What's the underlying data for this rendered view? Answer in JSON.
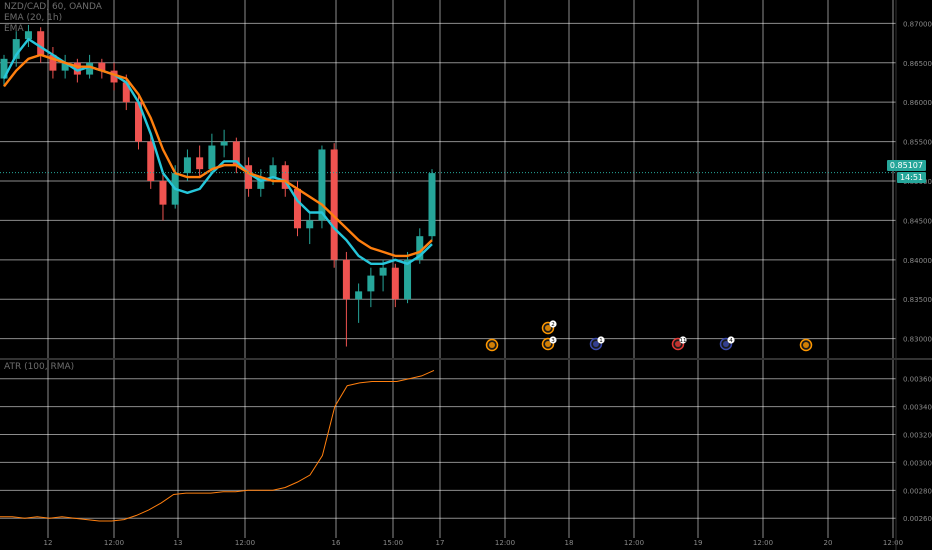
{
  "header": {
    "symbol_line": "NZD/CAD, 60, OANDA",
    "ema1_label": "EMA (20, 1h)",
    "ema2_label": "EMA"
  },
  "atr_panel": {
    "label": "ATR (100, RMA)"
  },
  "price_tags": {
    "last_price": "0.85107",
    "countdown": "14:51"
  },
  "colors": {
    "background": "#000000",
    "grid": "#ffffff",
    "up": "#26a69a",
    "down": "#ef5350",
    "ema_fast": "#26c6da",
    "ema_slow": "#ff7f0e",
    "atr": "#ff7f0e",
    "price_tag": "#26a69a"
  },
  "event_markers": [
    {
      "badge": "",
      "color": "#ff9800"
    },
    {
      "badge": "2",
      "color": "#ff9800"
    },
    {
      "badge": "3",
      "color": "#ff9800"
    },
    {
      "badge": "1",
      "color": "#3949ab"
    },
    {
      "badge": "11",
      "color": "#e53935"
    },
    {
      "badge": "4",
      "color": "#3949ab"
    },
    {
      "badge": "",
      "color": "#ff9800"
    }
  ],
  "chart_data": [
    {
      "type": "candlestick",
      "title": "NZD/CAD, 60, OANDA",
      "y_ticks": [
        "0.87000",
        "0.86500",
        "0.86000",
        "0.85500",
        "0.85000",
        "0.84500",
        "0.84000",
        "0.83500",
        "0.83000"
      ],
      "x_ticks": [
        "12",
        "12:00",
        "13",
        "12:00",
        "16",
        "15:00",
        "17",
        "12:00",
        "18",
        "12:00",
        "19",
        "12:00",
        "20",
        "12:00"
      ],
      "ylim": [
        0.8278,
        0.8722
      ],
      "grid": true,
      "series": [
        {
          "name": "EMA",
          "kind": "line",
          "y": [
            0.863,
            0.866,
            0.868,
            0.867,
            0.866,
            0.865,
            0.864,
            0.8645,
            0.864,
            0.8635,
            0.8625,
            0.86,
            0.856,
            0.851,
            0.849,
            0.8485,
            0.849,
            0.851,
            0.8525,
            0.8525,
            0.851,
            0.85,
            0.8505,
            0.85,
            0.8475,
            0.846,
            0.846,
            0.844,
            0.8425,
            0.8405,
            0.8395,
            0.8395,
            0.84,
            0.8395,
            0.8405,
            0.842
          ]
        },
        {
          "name": "EMA",
          "kind": "line",
          "y": [
            0.862,
            0.864,
            0.8655,
            0.866,
            0.8655,
            0.865,
            0.8645,
            0.8645,
            0.864,
            0.8635,
            0.863,
            0.861,
            0.858,
            0.854,
            0.851,
            0.8505,
            0.8505,
            0.8515,
            0.852,
            0.852,
            0.851,
            0.8505,
            0.85,
            0.85,
            0.849,
            0.848,
            0.847,
            0.8455,
            0.844,
            0.8425,
            0.8415,
            0.841,
            0.8405,
            0.8405,
            0.841,
            0.8425
          ]
        }
      ],
      "candles": [
        {
          "o": 0.863,
          "h": 0.866,
          "l": 0.862,
          "c": 0.8655
        },
        {
          "o": 0.8655,
          "h": 0.869,
          "l": 0.8645,
          "c": 0.868
        },
        {
          "o": 0.868,
          "h": 0.8698,
          "l": 0.867,
          "c": 0.869
        },
        {
          "o": 0.869,
          "h": 0.8695,
          "l": 0.865,
          "c": 0.866
        },
        {
          "o": 0.866,
          "h": 0.867,
          "l": 0.863,
          "c": 0.864
        },
        {
          "o": 0.864,
          "h": 0.866,
          "l": 0.863,
          "c": 0.865
        },
        {
          "o": 0.865,
          "h": 0.8655,
          "l": 0.8625,
          "c": 0.8635
        },
        {
          "o": 0.8635,
          "h": 0.866,
          "l": 0.863,
          "c": 0.865
        },
        {
          "o": 0.865,
          "h": 0.8655,
          "l": 0.863,
          "c": 0.864
        },
        {
          "o": 0.864,
          "h": 0.865,
          "l": 0.8615,
          "c": 0.8625
        },
        {
          "o": 0.8625,
          "h": 0.8635,
          "l": 0.859,
          "c": 0.86
        },
        {
          "o": 0.86,
          "h": 0.861,
          "l": 0.854,
          "c": 0.855
        },
        {
          "o": 0.855,
          "h": 0.856,
          "l": 0.849,
          "c": 0.85
        },
        {
          "o": 0.85,
          "h": 0.851,
          "l": 0.845,
          "c": 0.847
        },
        {
          "o": 0.847,
          "h": 0.852,
          "l": 0.8465,
          "c": 0.851
        },
        {
          "o": 0.851,
          "h": 0.854,
          "l": 0.85,
          "c": 0.853
        },
        {
          "o": 0.853,
          "h": 0.8545,
          "l": 0.8505,
          "c": 0.8515
        },
        {
          "o": 0.8515,
          "h": 0.856,
          "l": 0.851,
          "c": 0.8545
        },
        {
          "o": 0.8545,
          "h": 0.8565,
          "l": 0.853,
          "c": 0.855
        },
        {
          "o": 0.855,
          "h": 0.8555,
          "l": 0.851,
          "c": 0.852
        },
        {
          "o": 0.852,
          "h": 0.853,
          "l": 0.848,
          "c": 0.849
        },
        {
          "o": 0.849,
          "h": 0.8515,
          "l": 0.848,
          "c": 0.8505
        },
        {
          "o": 0.8505,
          "h": 0.853,
          "l": 0.8495,
          "c": 0.852
        },
        {
          "o": 0.852,
          "h": 0.8525,
          "l": 0.848,
          "c": 0.849
        },
        {
          "o": 0.849,
          "h": 0.85,
          "l": 0.843,
          "c": 0.844
        },
        {
          "o": 0.844,
          "h": 0.846,
          "l": 0.842,
          "c": 0.845
        },
        {
          "o": 0.845,
          "h": 0.8545,
          "l": 0.844,
          "c": 0.854
        },
        {
          "o": 0.854,
          "h": 0.8548,
          "l": 0.839,
          "c": 0.84
        },
        {
          "o": 0.84,
          "h": 0.841,
          "l": 0.829,
          "c": 0.835
        },
        {
          "o": 0.835,
          "h": 0.837,
          "l": 0.832,
          "c": 0.836
        },
        {
          "o": 0.836,
          "h": 0.839,
          "l": 0.834,
          "c": 0.838
        },
        {
          "o": 0.838,
          "h": 0.84,
          "l": 0.836,
          "c": 0.839
        },
        {
          "o": 0.839,
          "h": 0.8395,
          "l": 0.834,
          "c": 0.835
        },
        {
          "o": 0.835,
          "h": 0.841,
          "l": 0.8345,
          "c": 0.84
        },
        {
          "o": 0.84,
          "h": 0.844,
          "l": 0.8395,
          "c": 0.843
        },
        {
          "o": 0.843,
          "h": 0.8515,
          "l": 0.8425,
          "c": 0.851
        }
      ]
    },
    {
      "type": "line",
      "title": "ATR (100, RMA)",
      "y_ticks": [
        "0.00360",
        "0.00340",
        "0.00320",
        "0.00300",
        "0.00280",
        "0.00260"
      ],
      "ylim": [
        0.00253,
        0.00372
      ],
      "grid": true,
      "series": [
        {
          "name": "ATR",
          "y": [
            0.00261,
            0.00261,
            0.0026,
            0.00261,
            0.0026,
            0.00261,
            0.0026,
            0.00259,
            0.00258,
            0.00258,
            0.00259,
            0.00262,
            0.00266,
            0.00271,
            0.00277,
            0.00278,
            0.00278,
            0.00278,
            0.00279,
            0.00279,
            0.0028,
            0.0028,
            0.0028,
            0.00282,
            0.00286,
            0.00291,
            0.00305,
            0.0034,
            0.00355,
            0.00357,
            0.00358,
            0.00358,
            0.00358,
            0.0036,
            0.00362,
            0.00366
          ]
        }
      ]
    }
  ]
}
